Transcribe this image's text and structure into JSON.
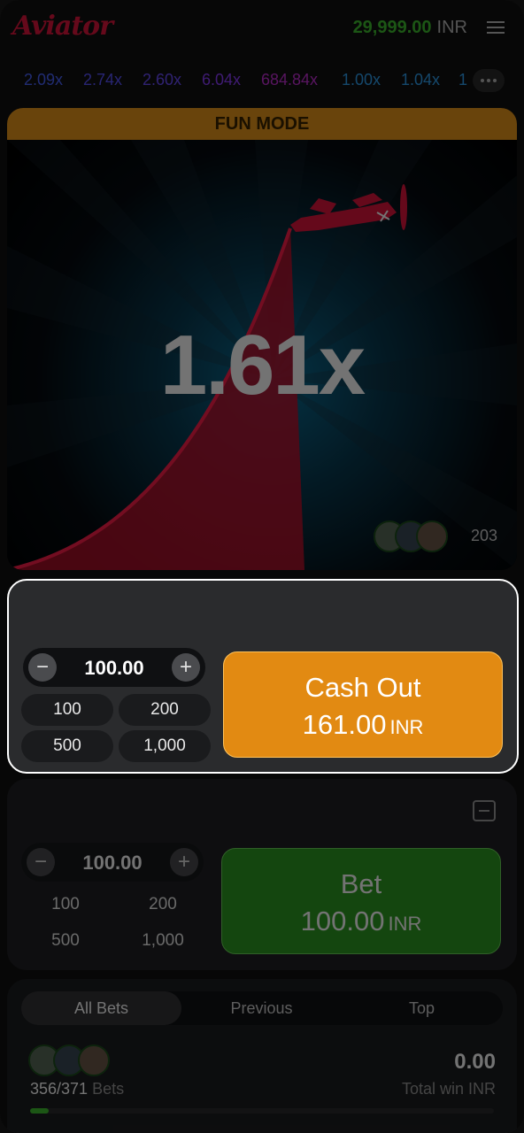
{
  "header": {
    "logo": "Aviator",
    "balance_amount": "29,999.00",
    "balance_currency": "INR"
  },
  "multipliers": [
    {
      "value": "2.09x",
      "color": "#4a63ff"
    },
    {
      "value": "2.74x",
      "color": "#5a52ff"
    },
    {
      "value": "2.60x",
      "color": "#6b4dff"
    },
    {
      "value": "6.04x",
      "color": "#8c3dff"
    },
    {
      "value": "684.84x",
      "color": "#c42fd6"
    },
    {
      "value": "1.00x",
      "color": "#2fa0f0"
    },
    {
      "value": "1.04x",
      "color": "#2fa0f0"
    },
    {
      "value": "1",
      "color": "#2fa0f0"
    }
  ],
  "game": {
    "mode_banner": "FUN MODE",
    "multiplier": "1.61x",
    "players_count": "203"
  },
  "bet_panel_1": {
    "amount": "100.00",
    "chips": [
      "100",
      "200",
      "500",
      "1,000"
    ],
    "action_title": "Cash Out",
    "action_amount": "161.00",
    "action_currency": "INR"
  },
  "bet_panel_2": {
    "amount": "100.00",
    "chips": [
      "100",
      "200",
      "500",
      "1,000"
    ],
    "action_title": "Bet",
    "action_amount": "100.00",
    "action_currency": "INR"
  },
  "bets_list": {
    "tabs": [
      "All Bets",
      "Previous",
      "Top"
    ],
    "bets_count": "356/371",
    "bets_label": "Bets",
    "total_win": "0.00",
    "total_win_label": "Total win INR",
    "progress_fraction": 0.04
  },
  "colors": {
    "accent_red": "#e0143c",
    "balance_green": "#3fbf2f",
    "fun_mode_orange": "#e8971c",
    "cashout_orange": "#e28a12",
    "bet_green": "#2e9b22"
  }
}
